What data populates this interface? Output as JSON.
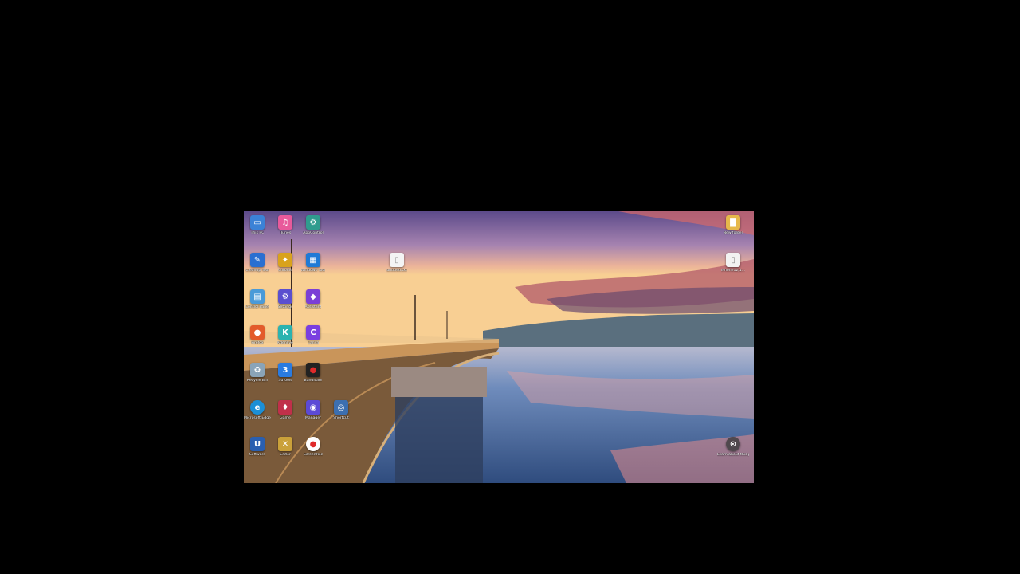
{
  "desktop": {
    "icons": [
      {
        "label": "This PC",
        "glyph": "▭",
        "color": "#3b82d6",
        "name": "this-pc-icon"
      },
      {
        "label": "iTunes",
        "glyph": "♫",
        "color": "#e85a9b",
        "name": "itunes-icon"
      },
      {
        "label": "AppControl",
        "glyph": "⚙",
        "color": "#2f9c8e",
        "name": "app-control-icon"
      },
      {
        "label": "Cleanup Tool",
        "glyph": "✎",
        "color": "#2a6fd1",
        "name": "cleanup-tool-icon"
      },
      {
        "label": "Chrome",
        "glyph": "✦",
        "color": "#d9a21c",
        "name": "chrome-icon"
      },
      {
        "label": "Windows Tool",
        "glyph": "▦",
        "color": "#1f7ad6",
        "name": "windows-tool-icon"
      },
      {
        "label": "Control Panel",
        "glyph": "▤",
        "color": "#4a9ad8",
        "name": "control-panel-icon"
      },
      {
        "label": "Settings",
        "glyph": "⚙",
        "color": "#5a4fcf",
        "name": "settings-icon"
      },
      {
        "label": "Assistant",
        "glyph": "◆",
        "color": "#7b3fd6",
        "name": "assistant-icon"
      },
      {
        "label": "Firefox",
        "glyph": "●",
        "color": "#e35b2b",
        "name": "firefox-icon"
      },
      {
        "label": "Kdenlive",
        "glyph": "K",
        "color": "#2bb3b0",
        "name": "kdenlive-icon"
      },
      {
        "label": "Canva",
        "glyph": "C",
        "color": "#7a3fe0",
        "name": "canva-icon"
      },
      {
        "label": "Recycle Bin",
        "glyph": "♻",
        "color": "#8aa4b8",
        "name": "recycle-bin-icon"
      },
      {
        "label": "3uTools",
        "glyph": "3",
        "color": "#2a7be0",
        "name": "3utools-icon"
      },
      {
        "label": "Bandicam",
        "glyph": "●",
        "color": "#222222",
        "name": "bandicam-icon"
      },
      {
        "label": "Microsoft Edge",
        "glyph": "e",
        "color": "#1c8fd6",
        "name": "edge-icon"
      },
      {
        "label": "Game",
        "glyph": "♦",
        "color": "#c0304a",
        "name": "game-icon"
      },
      {
        "label": "Manager",
        "glyph": "◉",
        "color": "#5c4ad6",
        "name": "manager-icon"
      },
      {
        "label": "Software",
        "glyph": "U",
        "color": "#2a5fb0",
        "name": "software-icon"
      },
      {
        "label": "Editor",
        "glyph": "✕",
        "color": "#caa13a",
        "name": "editor-icon"
      },
      {
        "label": "ScreenRec",
        "glyph": "●",
        "color": "#e02a2a",
        "name": "screenrec-icon"
      }
    ],
    "right_icons": [
      {
        "label": "New folder",
        "glyph": "▇",
        "color": "#e6b84a",
        "name": "new-folder-icon"
      },
      {
        "label": "iPhone12,1...",
        "glyph": "▯",
        "color": "#f2f2f2",
        "name": "iphone-file-icon"
      }
    ],
    "center_file": {
      "label": "untitled.txt",
      "glyph": "▯",
      "color": "#f4f4f4",
      "name": "text-file-icon"
    },
    "extra_icon": {
      "label": "Shortcut",
      "glyph": "◎",
      "color": "#3c6fb0",
      "name": "shortcut-icon"
    },
    "learn_icon": {
      "label": "Learn about this picture",
      "glyph": "⊙",
      "color": "#555555",
      "name": "learn-about-picture-icon"
    }
  }
}
